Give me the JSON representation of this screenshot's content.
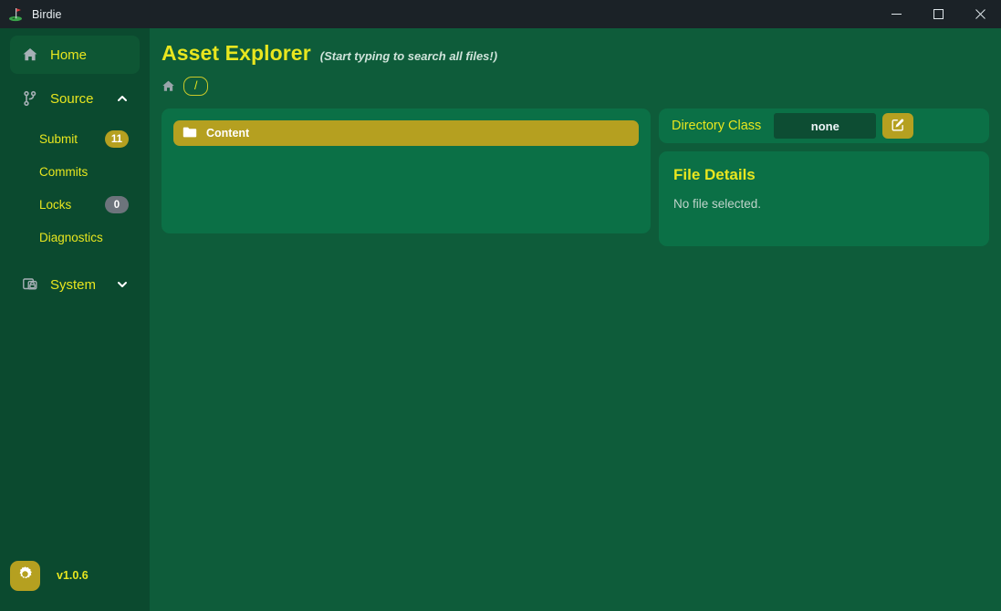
{
  "window": {
    "app_icon": "golf-flag-icon",
    "title": "Birdie",
    "controls": [
      {
        "name": "minimize-button",
        "icon": "minimize-icon"
      },
      {
        "name": "maximize-button",
        "icon": "maximize-icon"
      },
      {
        "name": "close-button",
        "icon": "close-icon"
      }
    ]
  },
  "sidebar": {
    "home": {
      "label": "Home",
      "icon": "home-icon"
    },
    "source": {
      "label": "Source",
      "icon": "git-branch-icon",
      "chevron": "chevron-up-icon",
      "expanded": true
    },
    "source_children": [
      {
        "label": "Submit",
        "badge": "11",
        "badge_style": "gold"
      },
      {
        "label": "Commits",
        "badge": null,
        "badge_style": null
      },
      {
        "label": "Locks",
        "badge": "0",
        "badge_style": "gray"
      },
      {
        "label": "Diagnostics",
        "badge": null,
        "badge_style": null
      }
    ],
    "system": {
      "label": "System",
      "icon": "server-lock-icon",
      "chevron": "chevron-down-icon",
      "expanded": false
    },
    "footer": {
      "settings_icon": "gear-icon",
      "version": "v1.0.6"
    }
  },
  "main": {
    "title": "Asset Explorer",
    "hint": "(Start typing to search all files!)",
    "breadcrumb": {
      "home_icon": "home-icon",
      "path": "/"
    },
    "file_list": [
      {
        "name": "Content",
        "icon": "folder-icon",
        "selected": true
      }
    ],
    "directory_class": {
      "label": "Directory Class",
      "value": "none",
      "edit_icon": "edit-square-icon"
    },
    "file_details": {
      "title": "File Details",
      "empty_text": "No file selected."
    }
  },
  "colors": {
    "titlebar": "#1b2227",
    "sidebar": "#0b4a2f",
    "background": "#0e5c3a",
    "card": "#0b7046",
    "accent_gold": "#b5a020",
    "accent_yellow": "#e8e61f",
    "badge_gray": "#6d747c",
    "input_dark": "#0d4d33"
  }
}
